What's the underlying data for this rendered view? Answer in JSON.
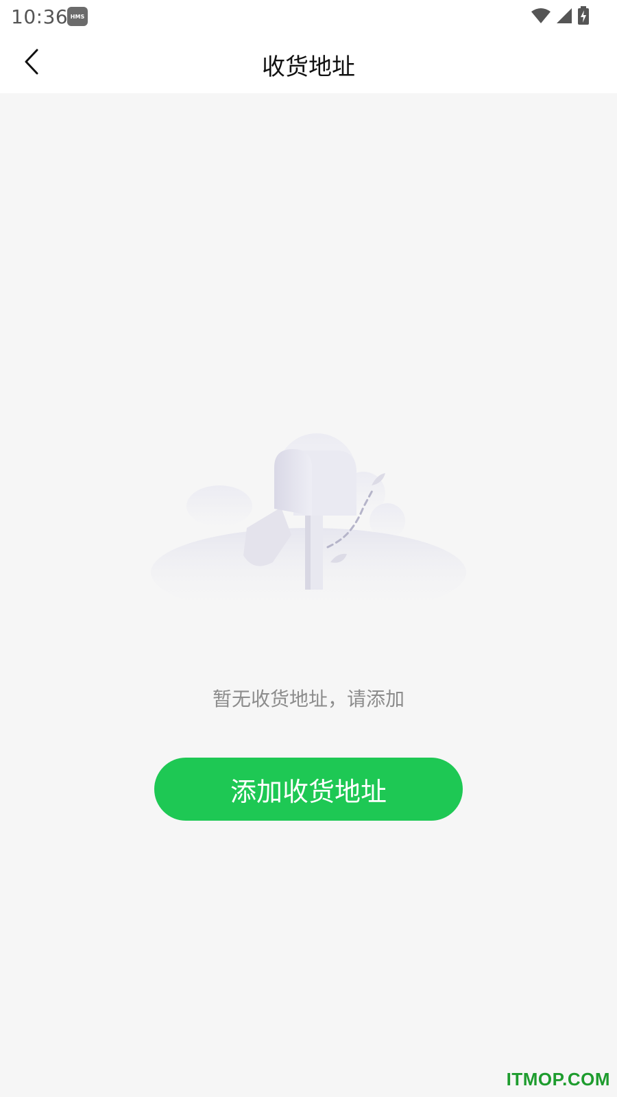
{
  "status_bar": {
    "time": "10:36",
    "badge": "HMS",
    "icons": [
      "wifi-icon",
      "signal-icon",
      "battery-charging-icon"
    ]
  },
  "header": {
    "title": "收货地址",
    "back_icon": "chevron-left-icon"
  },
  "empty_state": {
    "illustration": "mailbox-illustration",
    "message": "暂无收货地址，请添加"
  },
  "actions": {
    "add_address_label": "添加收货地址"
  },
  "watermark": "ITMOP.COM",
  "colors": {
    "accent": "#1ec854",
    "background": "#f6f6f6",
    "header_bg": "#ffffff",
    "muted_text": "#8c8c8c",
    "watermark": "#1e9c2e"
  }
}
